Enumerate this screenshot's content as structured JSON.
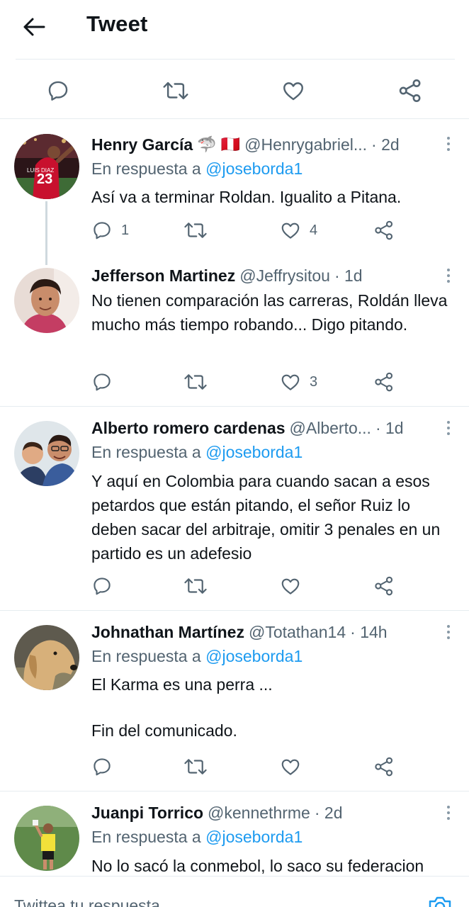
{
  "header": {
    "title": "Tweet"
  },
  "icons": {
    "accent": "#1d9bf0",
    "icon_color": "#536471"
  },
  "tweets": [
    {
      "name": "Henry García",
      "emoji": "🦈 🇵🇪",
      "handle": "@Henrygabriel...",
      "time": "· 2d",
      "reply_prefix": "En respuesta a ",
      "reply_mention": "@joseborda1",
      "text": "Así va a terminar Roldan. Igualito a Pitana.",
      "replies": "1",
      "likes": "4",
      "avatar": "soccer-player-avatar"
    },
    {
      "name": "Jefferson Martinez",
      "handle": "@Jeffrysitou",
      "time": "· 1d",
      "text": "No tienen comparación las carreras, Roldán lleva mucho más tiempo robando... Digo pitando.",
      "replies": "",
      "likes": "3",
      "avatar": "young-man-avatar"
    },
    {
      "name": "Alberto romero cardenas",
      "handle": "@Alberto...",
      "time": "· 1d",
      "reply_prefix": "En respuesta a ",
      "reply_mention": "@joseborda1",
      "text": "Y aquí en Colombia para cuando sacan a esos petardos que están pitando, el señor Ruiz lo deben sacar del arbitraje, omitir 3 penales en un partido es un adefesio",
      "replies": "",
      "likes": "",
      "avatar": "father-and-son-avatar"
    },
    {
      "name": "Johnathan Martínez",
      "handle": "@Totathan14",
      "time": "· 14h",
      "reply_prefix": "En respuesta a ",
      "reply_mention": "@joseborda1",
      "text": "El Karma es una perra ...\n\nFin del comunicado.",
      "replies": "",
      "likes": "",
      "avatar": "dog-avatar"
    },
    {
      "name": "Juanpi Torrico",
      "handle": "@kennethrme",
      "time": "· 2d",
      "reply_prefix": "En respuesta a ",
      "reply_mention": "@joseborda1",
      "text": "No lo sacó la conmebol, lo saco su federacion",
      "avatar": "referee-avatar"
    }
  ],
  "reply_bar": {
    "placeholder": "Twittea tu respuesta"
  }
}
